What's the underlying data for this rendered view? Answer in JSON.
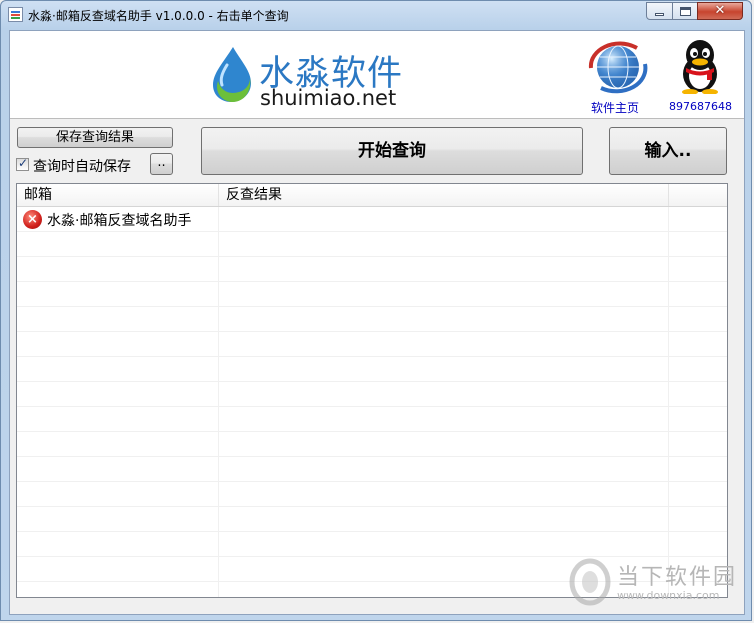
{
  "window": {
    "title": "水淼·邮箱反查域名助手 v1.0.0.0 - 右击单个查询",
    "close_glyph": "✕"
  },
  "banner": {
    "logo_cn": "水淼软件",
    "logo_en": "shuimiao.net",
    "home_link": "软件主页",
    "qq_link": "897687648"
  },
  "controls": {
    "save_results_label": "保存查询结果",
    "auto_save_label": "查询时自动保存",
    "auto_save_checked": true,
    "browse_label": "..",
    "start_label": "开始查询",
    "input_label": "输入.."
  },
  "list": {
    "columns": [
      "邮箱",
      "反查结果"
    ],
    "rows": [
      {
        "status": "error",
        "email": "水淼·邮箱反查域名助手",
        "result": ""
      }
    ]
  },
  "watermark": {
    "cn": "当下软件园",
    "en": "www.downxia.com"
  }
}
